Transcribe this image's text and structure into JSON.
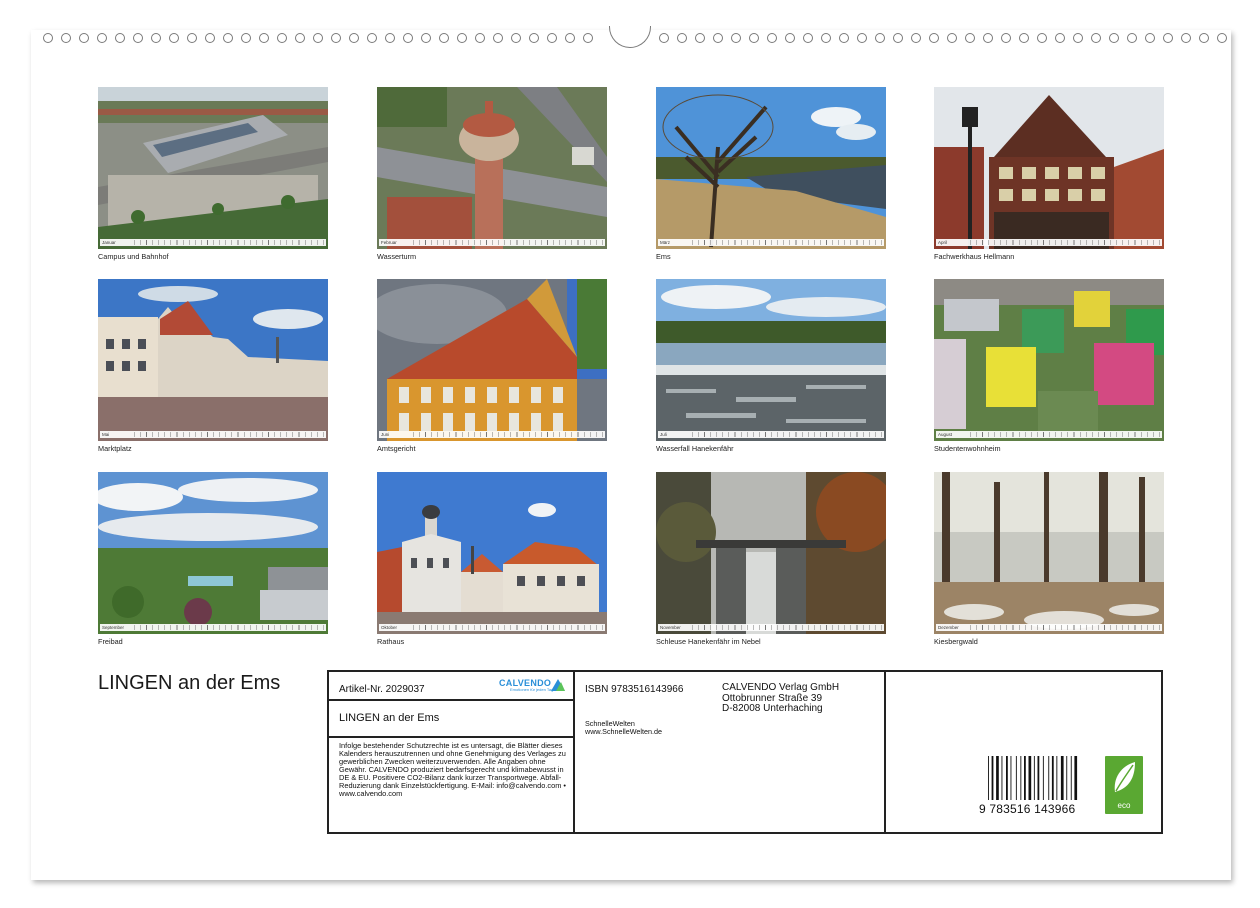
{
  "months": [
    {
      "caption": "Campus und Bahnhof",
      "month": "Januar"
    },
    {
      "caption": "Wasserturm",
      "month": "Februar"
    },
    {
      "caption": "Ems",
      "month": "März"
    },
    {
      "caption": "Fachwerkhaus Hellmann",
      "month": "April"
    },
    {
      "caption": "Marktplatz",
      "month": "Mai"
    },
    {
      "caption": "Amtsgericht",
      "month": "Juni"
    },
    {
      "caption": "Wasserfall Hanekenfähr",
      "month": "Juli"
    },
    {
      "caption": "Studentenwohnheim",
      "month": "August"
    },
    {
      "caption": "Freibad",
      "month": "September"
    },
    {
      "caption": "Rathaus",
      "month": "Oktober"
    },
    {
      "caption": "Schleuse Hanekenfähr im Nebel",
      "month": "November"
    },
    {
      "caption": "Kiesbergwald",
      "month": "Dezember"
    }
  ],
  "calendar_title": "LINGEN an der Ems",
  "info": {
    "artikel": "Artikel-Nr. 2029037",
    "logo": "CALVENDO",
    "logo_sub": "Emotionen für jeden Tag",
    "title": "LINGEN an der Ems",
    "legal": "Infolge bestehender Schutzrechte ist es untersagt, die Blätter dieses Kalenders herauszutrennen und ohne Genehmigung des Verlages zu gewerblichen Zwecken weiterzuverwenden. Alle Angaben ohne Gewähr. CALVENDO produziert bedarfsgerecht und klimabewusst in DE & EU. Positivere CO2-Bilanz dank kurzer Transportwege. Abfall-Reduzierung dank Einzelstückfertigung. E-Mail: info@calvendo.com • www.calvendo.com",
    "isbn": "ISBN 9783516143966",
    "publisher_name": "SchnelleWelten",
    "publisher_url": "www.SchnelleWelten.de",
    "verlag_line1": "CALVENDO Verlag GmbH",
    "verlag_line2": "Ottobrunner Straße 39",
    "verlag_line3": "D-82008 Unterhaching",
    "barcode_number": "9 783516 143966",
    "eco_label": "eco"
  },
  "colors": {
    "calvendo_blue": "#2a8fd8",
    "eco_green": "#5aa832"
  }
}
